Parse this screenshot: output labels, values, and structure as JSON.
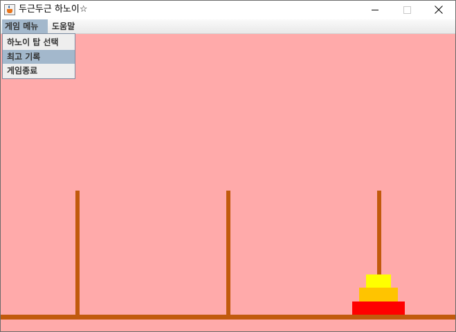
{
  "window": {
    "title": "두근두근 하노이☆",
    "minimize_icon": "minimize-icon",
    "maximize_icon": "maximize-icon",
    "close_icon": "close-icon",
    "app_icon": "java-cup-icon"
  },
  "menubar": {
    "menus": [
      {
        "label": "게임 메뉴"
      },
      {
        "label": "도움말"
      }
    ]
  },
  "dropdown": {
    "items": [
      {
        "label": "하노이 탑 선택"
      },
      {
        "label": "최고 기록"
      },
      {
        "label": "게임종료"
      }
    ],
    "highlighted_index": 1
  },
  "game": {
    "peg_count": 3,
    "disk_peg": 3,
    "disks_bottom_to_top": [
      {
        "color": "#ff0000"
      },
      {
        "color": "#ffc400"
      },
      {
        "color": "#ffff00"
      }
    ],
    "peg_color": "#c15a0d",
    "background_color": "#ffaaaa"
  }
}
